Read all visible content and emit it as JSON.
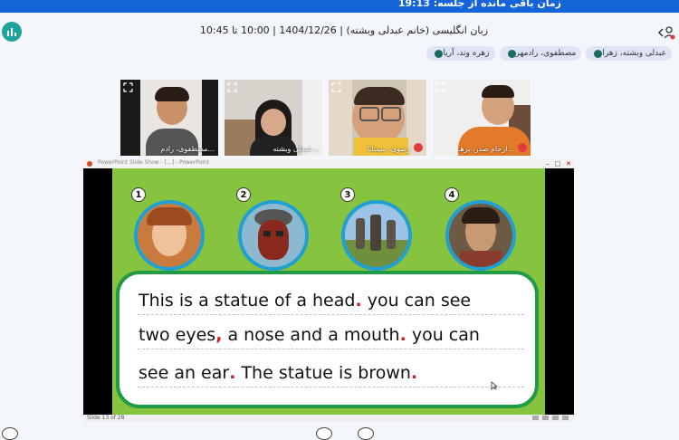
{
  "topbar": {
    "timer_text": "زمان باقی مانده از جلسه: 19:13"
  },
  "header": {
    "title": "زبان انگلیسی (خانم عبدلی وبشته) | 1404/12/26 | 10:00 تا 10:45"
  },
  "chips": [
    {
      "label": "عبدلی وبشته، زهرا"
    },
    {
      "label": "مصطفوی، رادمهر"
    },
    {
      "label": "زهره وند، آریا"
    }
  ],
  "tiles": [
    {
      "name": "مصطفوی، رادم..."
    },
    {
      "name": "عبدلی وبشته..."
    },
    {
      "name": "رضوی، سپنتایا"
    },
    {
      "name": "ارحام صدر، برهـ..."
    }
  ],
  "slide": {
    "window_title": "PowerPoint Slide Show - [...] - PowerPoint",
    "numbers": [
      "1",
      "2",
      "3",
      "4"
    ],
    "lines": [
      {
        "text": "This is a statue of a head",
        "mark": ".",
        "rest": " you can see"
      },
      {
        "text": "two eyes",
        "mark": ",",
        "rest": " a nose and a mouth",
        "mark2": ".",
        "rest2": " you can"
      },
      {
        "text": "see an ear",
        "mark": ".",
        "rest": " The statue is brown",
        "mark2": "."
      }
    ],
    "status_text": "Slide 13 of 28"
  },
  "colors": {
    "topbar": "#1565d8",
    "slide_bg": "#86c33e",
    "circle_border": "#1f9fd4",
    "textbox_border": "#1f9c45",
    "accent_teal": "#1ea49a"
  }
}
